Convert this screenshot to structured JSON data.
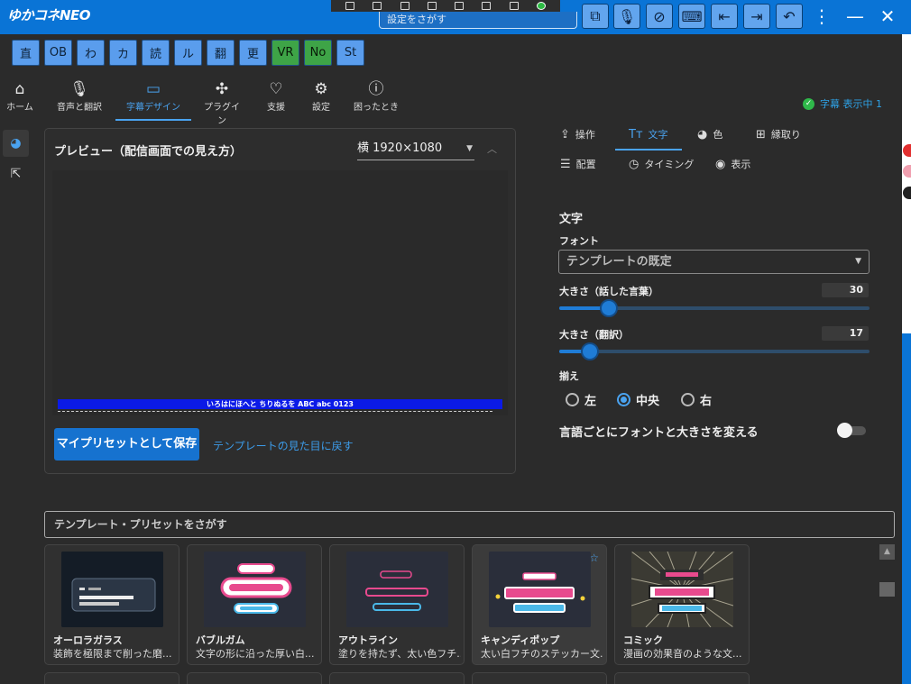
{
  "app": {
    "title": "ゆかコネNEO",
    "search_placeholder": "設定をさがす"
  },
  "toolbar_icons": [
    "pip-icon",
    "mic-icon",
    "mic-off-icon",
    "keyboard-icon",
    "input-left-icon",
    "input-right-icon",
    "undo-icon"
  ],
  "window_controls": {
    "more": "⋮",
    "minimize": "—",
    "close": "✕"
  },
  "modes": [
    {
      "label": "直",
      "color": "#5a9ded"
    },
    {
      "label": "OB",
      "color": "#5a9ded"
    },
    {
      "label": "わ",
      "color": "#5a9ded"
    },
    {
      "label": "カ",
      "color": "#5a9ded"
    },
    {
      "label": "読",
      "color": "#5a9ded"
    },
    {
      "label": "ル",
      "color": "#5a9ded"
    },
    {
      "label": "翻",
      "color": "#5a9ded"
    },
    {
      "label": "更",
      "color": "#5a9ded"
    },
    {
      "label": "VR",
      "color": "#3ea447"
    },
    {
      "label": "No",
      "color": "#3ea447"
    },
    {
      "label": "St",
      "color": "#5a9ded"
    }
  ],
  "nav": [
    {
      "label": "ホーム",
      "icon": "home-icon"
    },
    {
      "label": "音声と翻訳",
      "icon": "mic-icon"
    },
    {
      "label": "字幕デザイン",
      "icon": "subtitles-icon",
      "active": true
    },
    {
      "label": "プラグイン",
      "icon": "puzzle-icon"
    },
    {
      "label": "支援",
      "icon": "heart-icon"
    },
    {
      "label": "設定",
      "icon": "gear-icon"
    },
    {
      "label": "困ったとき",
      "icon": "help-icon"
    }
  ],
  "status": {
    "text": "字幕 表示中 1"
  },
  "preview": {
    "title": "プレビュー（配信画面での見え方）",
    "orientation": "横 1920×1080",
    "sample_text": "いろはにほへと ちりぬるを ABC abc 0123",
    "save_button": "マイプリセットとして保存",
    "reset_link": "テンプレートの見た目に戻す"
  },
  "right_tabs": [
    {
      "label": "操作",
      "icon": "share-icon"
    },
    {
      "label": "文字",
      "icon": "text-icon",
      "active": true
    },
    {
      "label": "色",
      "icon": "palette-icon"
    },
    {
      "label": "縁取り",
      "icon": "border-icon"
    },
    {
      "label": "配置",
      "icon": "align-icon"
    },
    {
      "label": "タイミング",
      "icon": "timer-icon"
    },
    {
      "label": "表示",
      "icon": "eye-icon"
    }
  ],
  "text_settings": {
    "section_title": "文字",
    "font_label": "フォント",
    "font_value": "テンプレートの既定",
    "size_spoken_label": "大きさ（話した言葉）",
    "size_spoken_value": "30",
    "size_spoken_fraction": 0.16,
    "size_trans_label": "大きさ（翻訳）",
    "size_trans_value": "17",
    "size_trans_fraction": 0.1,
    "align_label": "揃え",
    "align_options": [
      "左",
      "中央",
      "右"
    ],
    "align_selected": "中央",
    "per_language_label": "言語ごとにフォントと大きさを変える",
    "per_language_on": false
  },
  "templates": {
    "search_placeholder": "テンプレート・プリセットをさがす",
    "items": [
      {
        "name": "オーロラガラス",
        "desc": "装飾を極限まで削った磨..."
      },
      {
        "name": "バブルガム",
        "desc": "文字の形に沿った厚い白..."
      },
      {
        "name": "アウトライン",
        "desc": "塗りを持たず、太い色フチ..."
      },
      {
        "name": "キャンディポップ",
        "desc": "太い白フチのステッカー文..."
      },
      {
        "name": "コミック",
        "desc": "漫画の効果音のような文..."
      }
    ]
  },
  "colors": {
    "accent": "#4aa3f0",
    "titlebar": "#0a74d6",
    "mode_blue": "#5a9ded",
    "mode_green": "#3ea447"
  }
}
